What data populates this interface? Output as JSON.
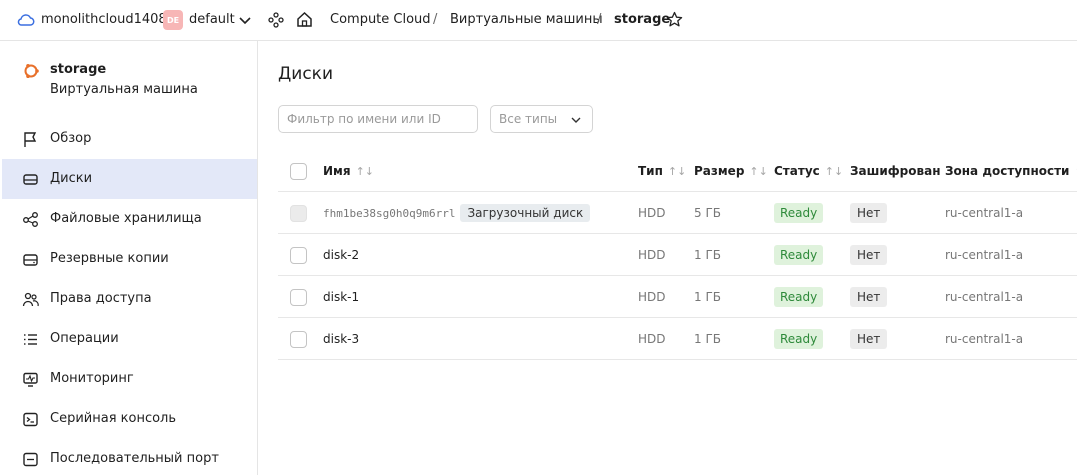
{
  "topbar": {
    "cloud_name": "monolithcloud1408",
    "folder_badge": "DE",
    "folder_name": "default",
    "breadcrumbs": [
      "Compute Cloud",
      "Виртуальные машины",
      "storage"
    ],
    "separator": "/"
  },
  "sidebar": {
    "vm_name": "storage",
    "vm_subtitle": "Виртуальная машина",
    "items": [
      {
        "label": "Обзор",
        "icon": "flag-icon"
      },
      {
        "label": "Диски",
        "icon": "disk-icon",
        "active": true
      },
      {
        "label": "Файловые хранилища",
        "icon": "share-icon"
      },
      {
        "label": "Резервные копии",
        "icon": "backup-icon"
      },
      {
        "label": "Права доступа",
        "icon": "users-icon"
      },
      {
        "label": "Операции",
        "icon": "list-icon"
      },
      {
        "label": "Мониторинг",
        "icon": "monitor-icon"
      },
      {
        "label": "Серийная консоль",
        "icon": "terminal-icon"
      },
      {
        "label": "Последовательный порт",
        "icon": "port-icon"
      }
    ]
  },
  "main": {
    "title": "Диски",
    "filter_placeholder": "Фильтр по имени или ID",
    "type_select": "Все типы",
    "columns": [
      "Имя",
      "Тип",
      "Размер",
      "Статус",
      "Зашифрован",
      "Зона доступности"
    ],
    "rows": [
      {
        "name": "fhm1be38sg0h0q9m6rrl",
        "boot_badge": "Загрузочный диск",
        "type": "HDD",
        "size": "5 ГБ",
        "status": "Ready",
        "encrypted": "Нет",
        "zone": "ru-central1-a",
        "disabled": true
      },
      {
        "name": "disk-2",
        "type": "HDD",
        "size": "1 ГБ",
        "status": "Ready",
        "encrypted": "Нет",
        "zone": "ru-central1-a"
      },
      {
        "name": "disk-1",
        "type": "HDD",
        "size": "1 ГБ",
        "status": "Ready",
        "encrypted": "Нет",
        "zone": "ru-central1-a"
      },
      {
        "name": "disk-3",
        "type": "HDD",
        "size": "1 ГБ",
        "status": "Ready",
        "encrypted": "Нет",
        "zone": "ru-central1-a"
      }
    ]
  },
  "colors": {
    "accent": "#e3e8f8",
    "status_ready_bg": "#dff2dc",
    "status_ready_text": "#2e8a3a",
    "folder_badge_bg": "#f7b6b6",
    "vm_icon": "#e8702a"
  }
}
